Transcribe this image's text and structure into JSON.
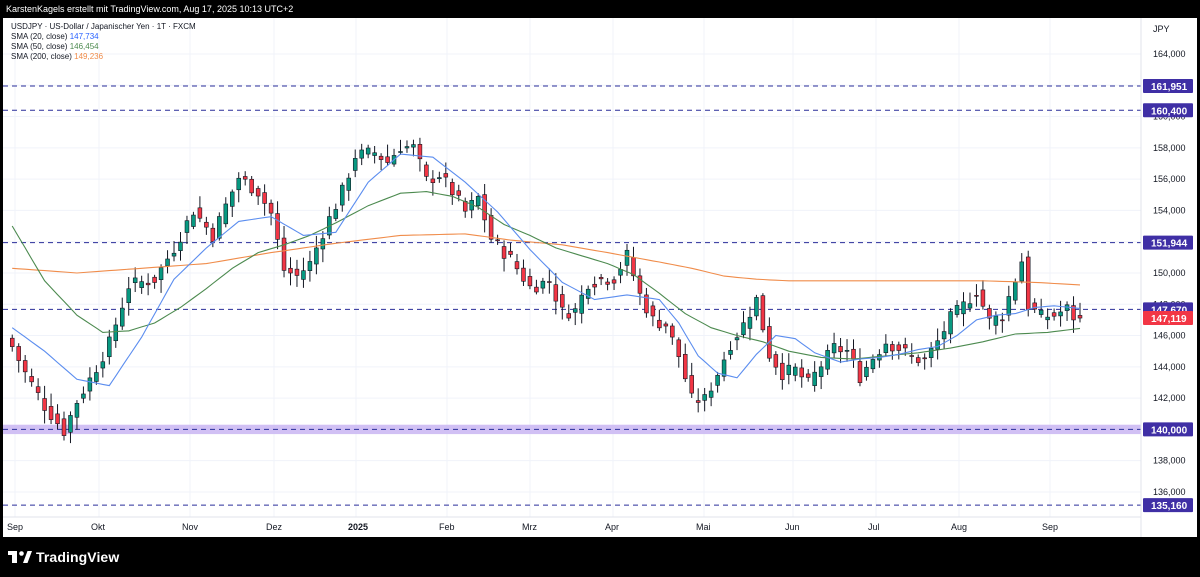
{
  "header": {
    "attribution": "KarstenKagels erstellt mit TradingView.com, Aug 17, 2025 10:13 UTC+2"
  },
  "legend": {
    "symbol": "USDJPY · US-Dollar / Japanischer Yen · 1T · FXCM",
    "sma20_label": "SMA (20, close)",
    "sma20_value": "147,734",
    "sma50_label": "SMA (50, close)",
    "sma50_value": "146,454",
    "sma200_label": "SMA (200, close)",
    "sma200_value": "149,236"
  },
  "footer": {
    "brand": "TradingView"
  },
  "colors": {
    "up": "#089981",
    "down": "#f23645",
    "sma20": "#5b8def",
    "sma50": "#4c8a4f",
    "sma200": "#f08c4a",
    "level_line": "#2a2e9a",
    "level_label_bg": "#3f2fa5",
    "support_band": "#c9b5f2",
    "price_label_bg": "#f23645",
    "sma_label_bg": "#2f2a99"
  },
  "chart_data": {
    "type": "candlestick",
    "currency": "JPY",
    "y_axis_ticks": [
      "164,000",
      "162,000",
      "160,000",
      "158,000",
      "156,000",
      "154,000",
      "152,000",
      "150,000",
      "148,000",
      "146,000",
      "144,000",
      "142,000",
      "140,000",
      "138,000",
      "136,000"
    ],
    "ylim": [
      134.4,
      166.3
    ],
    "x_axis_labels": [
      "Sep",
      "Okt",
      "Nov",
      "Dez",
      "2025",
      "Feb",
      "Mrz",
      "Apr",
      "Mai",
      "Jun",
      "Jul",
      "Aug",
      "Sep"
    ],
    "x_axis_bold": "2025",
    "horizontal_levels": [
      {
        "value": 161.951,
        "label": "161,951"
      },
      {
        "value": 160.4,
        "label": "160,400"
      },
      {
        "value": 151.944,
        "label": "151,944"
      },
      {
        "value": 147.67,
        "label": "147,670"
      },
      {
        "value": 135.16,
        "label": "135,160"
      }
    ],
    "support_zone": {
      "from": 139.7,
      "to": 140.3,
      "label": "140,000"
    },
    "last_price": {
      "value": 147.119,
      "label": "147,119"
    },
    "sma_values": {
      "sma20": 147.734,
      "sma50": 146.454,
      "sma200": 149.236
    },
    "price_path": [
      [
        0,
        145.3
      ],
      [
        2,
        143.6
      ],
      [
        5,
        141.5
      ],
      [
        8,
        139.9
      ],
      [
        10,
        141.8
      ],
      [
        12,
        143.2
      ],
      [
        15,
        145.5
      ],
      [
        18,
        149.2
      ],
      [
        22,
        149.6
      ],
      [
        25,
        151.6
      ],
      [
        28,
        154.0
      ],
      [
        31,
        152.4
      ],
      [
        33,
        154.3
      ],
      [
        35,
        156.1
      ],
      [
        38,
        155.2
      ],
      [
        40,
        153.8
      ],
      [
        42,
        150.2
      ],
      [
        44,
        149.8
      ],
      [
        46,
        150.6
      ],
      [
        48,
        152.6
      ],
      [
        51,
        155.2
      ],
      [
        53,
        157.5
      ],
      [
        56,
        157.7
      ],
      [
        58,
        157.1
      ],
      [
        60,
        158.1
      ],
      [
        62,
        158.0
      ],
      [
        64,
        155.9
      ],
      [
        66,
        156.3
      ],
      [
        68,
        155.2
      ],
      [
        70,
        153.9
      ],
      [
        72,
        154.8
      ],
      [
        74,
        152.2
      ],
      [
        77,
        150.9
      ],
      [
        80,
        149.1
      ],
      [
        83,
        149.5
      ],
      [
        85,
        147.5
      ],
      [
        87,
        147.6
      ],
      [
        89,
        149.4
      ],
      [
        91,
        149.6
      ],
      [
        93,
        149.7
      ],
      [
        95,
        151.1
      ],
      [
        97,
        148.6
      ],
      [
        99,
        147.0
      ],
      [
        101,
        146.7
      ],
      [
        103,
        144.7
      ],
      [
        105,
        141.9
      ],
      [
        107,
        141.9
      ],
      [
        109,
        143.6
      ],
      [
        111,
        145.5
      ],
      [
        113,
        146.7
      ],
      [
        115,
        148.3
      ],
      [
        117,
        144.8
      ],
      [
        119,
        143.6
      ],
      [
        121,
        143.8
      ],
      [
        123,
        142.9
      ],
      [
        125,
        144.1
      ],
      [
        127,
        145.2
      ],
      [
        129,
        145.0
      ],
      [
        131,
        143.4
      ],
      [
        133,
        144.6
      ],
      [
        135,
        145.6
      ],
      [
        137,
        145.2
      ],
      [
        139,
        144.6
      ],
      [
        141,
        144.4
      ],
      [
        143,
        145.6
      ],
      [
        145,
        147.1
      ],
      [
        147,
        147.9
      ],
      [
        149,
        148.9
      ],
      [
        151,
        146.9
      ],
      [
        153,
        147.3
      ],
      [
        155,
        149.6
      ],
      [
        156,
        150.8
      ],
      [
        157,
        147.9
      ],
      [
        159,
        147.2
      ],
      [
        161,
        147.3
      ],
      [
        163,
        147.7
      ],
      [
        164,
        147.2
      ],
      [
        165,
        147.119
      ]
    ],
    "sma20_path": [
      [
        0,
        146.5
      ],
      [
        5,
        145.0
      ],
      [
        10,
        143.2
      ],
      [
        15,
        142.8
      ],
      [
        20,
        145.9
      ],
      [
        25,
        149.6
      ],
      [
        30,
        151.6
      ],
      [
        35,
        153.3
      ],
      [
        40,
        153.6
      ],
      [
        45,
        152.4
      ],
      [
        50,
        152.6
      ],
      [
        55,
        155.8
      ],
      [
        60,
        157.6
      ],
      [
        65,
        157.4
      ],
      [
        70,
        155.8
      ],
      [
        75,
        153.9
      ],
      [
        80,
        151.5
      ],
      [
        85,
        149.4
      ],
      [
        90,
        148.3
      ],
      [
        95,
        148.6
      ],
      [
        100,
        148.3
      ],
      [
        103,
        146.8
      ],
      [
        106,
        144.7
      ],
      [
        109,
        143.6
      ],
      [
        112,
        143.3
      ],
      [
        115,
        144.8
      ],
      [
        118,
        146.0
      ],
      [
        121,
        145.8
      ],
      [
        124,
        144.9
      ],
      [
        128,
        144.3
      ],
      [
        131,
        144.5
      ],
      [
        134,
        144.6
      ],
      [
        137,
        144.8
      ],
      [
        140,
        145.1
      ],
      [
        143,
        145.3
      ],
      [
        146,
        146.0
      ],
      [
        149,
        147.0
      ],
      [
        152,
        147.3
      ],
      [
        155,
        147.4
      ],
      [
        158,
        147.8
      ],
      [
        161,
        147.9
      ],
      [
        165,
        147.734
      ]
    ],
    "sma50_path": [
      [
        0,
        153.0
      ],
      [
        5,
        149.5
      ],
      [
        10,
        147.3
      ],
      [
        14,
        146.2
      ],
      [
        18,
        146.3
      ],
      [
        22,
        146.8
      ],
      [
        26,
        147.8
      ],
      [
        30,
        149.0
      ],
      [
        34,
        150.3
      ],
      [
        38,
        151.3
      ],
      [
        42,
        151.8
      ],
      [
        46,
        152.4
      ],
      [
        50,
        153.2
      ],
      [
        55,
        154.3
      ],
      [
        60,
        155.1
      ],
      [
        64,
        155.2
      ],
      [
        68,
        154.9
      ],
      [
        72,
        154.2
      ],
      [
        76,
        153.1
      ],
      [
        80,
        152.4
      ],
      [
        84,
        151.6
      ],
      [
        88,
        151.1
      ],
      [
        92,
        150.6
      ],
      [
        96,
        149.9
      ],
      [
        100,
        148.7
      ],
      [
        104,
        147.4
      ],
      [
        108,
        146.5
      ],
      [
        112,
        146.0
      ],
      [
        116,
        145.6
      ],
      [
        120,
        145.0
      ],
      [
        125,
        144.6
      ],
      [
        130,
        144.5
      ],
      [
        135,
        144.7
      ],
      [
        140,
        144.9
      ],
      [
        145,
        145.2
      ],
      [
        150,
        145.6
      ],
      [
        155,
        146.1
      ],
      [
        160,
        146.2
      ],
      [
        165,
        146.454
      ]
    ],
    "sma200_path": [
      [
        0,
        150.3
      ],
      [
        10,
        150.0
      ],
      [
        20,
        150.3
      ],
      [
        30,
        150.6
      ],
      [
        40,
        151.3
      ],
      [
        50,
        151.9
      ],
      [
        60,
        152.4
      ],
      [
        70,
        152.5
      ],
      [
        77,
        152.1
      ],
      [
        85,
        151.8
      ],
      [
        92,
        151.3
      ],
      [
        100,
        150.7
      ],
      [
        105,
        150.3
      ],
      [
        110,
        149.8
      ],
      [
        115,
        149.6
      ],
      [
        120,
        149.5
      ],
      [
        130,
        149.5
      ],
      [
        140,
        149.5
      ],
      [
        150,
        149.5
      ],
      [
        158,
        149.4
      ],
      [
        165,
        149.236
      ]
    ]
  }
}
